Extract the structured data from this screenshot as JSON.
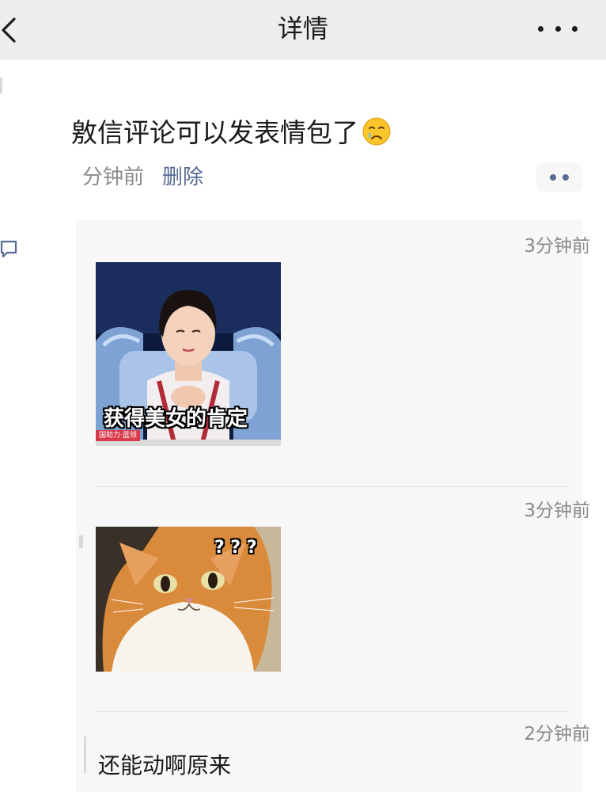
{
  "navbar": {
    "title": "详情",
    "back_icon": "chevron-left-icon",
    "more_icon": "more-dots-icon"
  },
  "post": {
    "text": "敫信评论可以发表情包了",
    "emoji": "crying-face-emoji",
    "time": "分钟前",
    "delete_label": "删除",
    "action_icon": "two-dots-icon"
  },
  "comments": [
    {
      "time": "3分钟前",
      "sticker_caption": "获得美女的肯定",
      "sticker_watermark": "国助力·蓝领"
    },
    {
      "time": "3分钟前",
      "sticker_caption": "? ? ?"
    },
    {
      "time": "2分钟前",
      "text": "还能动啊原来"
    }
  ],
  "colors": {
    "navbar_bg": "#ededed",
    "link": "#576b95",
    "comment_bg": "#f7f7f7",
    "secondary_text": "#8a8a8a"
  }
}
